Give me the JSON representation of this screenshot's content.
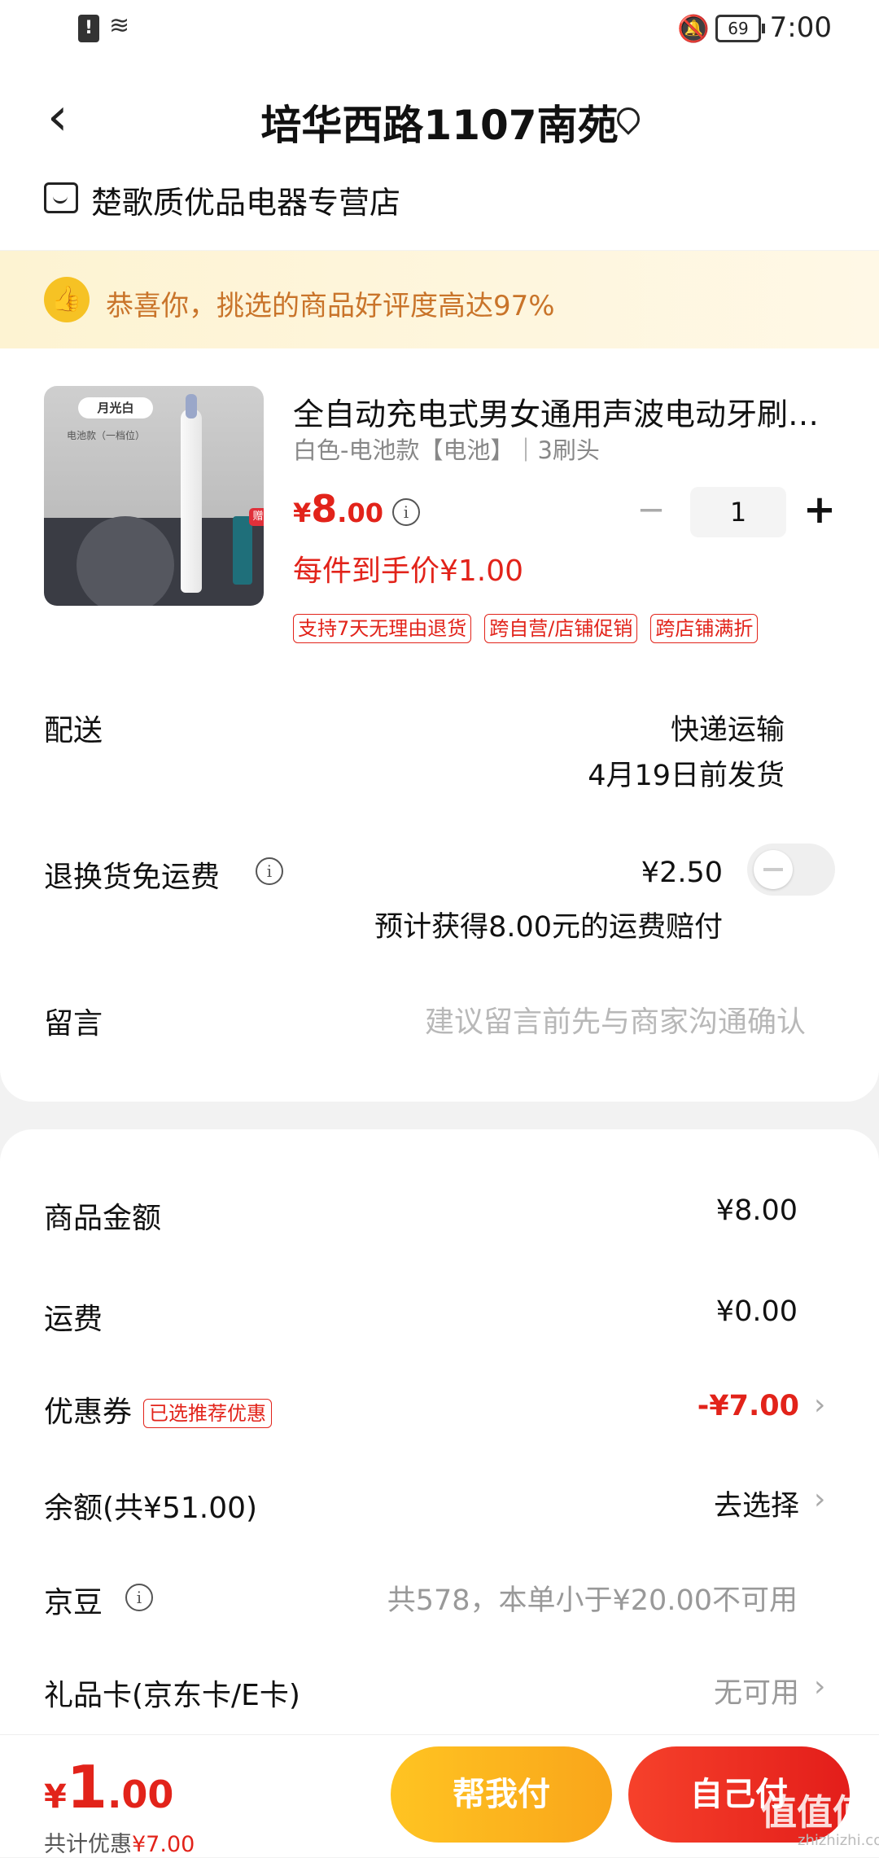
{
  "status_bar": {
    "time": "7:00",
    "battery": "69"
  },
  "header": {
    "address": "培华西路1107南苑",
    "shop_name": "楚歌质优品电器专营店"
  },
  "banner": {
    "text": "恭喜你，挑选的商品好评度高达97%"
  },
  "product": {
    "image_tag": "月光白",
    "image_sub": "电池款（一档位）",
    "image_badge": "赠",
    "title": "全自动充电式男女通用声波电动牙刷…",
    "spec": "白色-电池款【电池】｜3刷头",
    "price_symbol": "¥",
    "price_int": "8",
    "price_dec": ".00",
    "unit_price": "每件到手价¥1.00",
    "quantity": "1",
    "badges": [
      "支持7天无理由退货",
      "跨自营/店铺促销",
      "跨店铺满折"
    ]
  },
  "delivery": {
    "label": "配送",
    "method": "快递运输",
    "date": "4月19日前发货"
  },
  "return_shipping": {
    "label": "退换货免运费",
    "price": "¥2.50",
    "note": "预计获得8.00元的运费赔付",
    "enabled": false
  },
  "message": {
    "label": "留言",
    "placeholder": "建议留言前先与商家沟通确认"
  },
  "summary": {
    "goods_label": "商品金额",
    "goods_value": "¥8.00",
    "freight_label": "运费",
    "freight_value": "¥0.00",
    "coupon_label": "优惠券",
    "coupon_tag": "已选推荐优惠",
    "coupon_value": "-¥7.00",
    "balance_label": "余额(共¥51.00)",
    "balance_value": "去选择",
    "jingdou_label": "京豆",
    "jingdou_value": "共578，本单小于¥20.00不可用",
    "giftcard_label": "礼品卡(京东卡/E卡)",
    "giftcard_value": "无可用"
  },
  "footer": {
    "total_symbol": "¥",
    "total_int": "1",
    "total_dec": ".00",
    "saved_label": "共计优惠",
    "saved_value": "¥7.00",
    "help_pay": "帮我付",
    "self_pay": "自己付"
  },
  "watermark": {
    "logo": "值值值",
    "site": "zhizhizhi.com"
  },
  "colors": {
    "accent_red": "#e2231a",
    "accent_yellow": "#f9a51a"
  }
}
